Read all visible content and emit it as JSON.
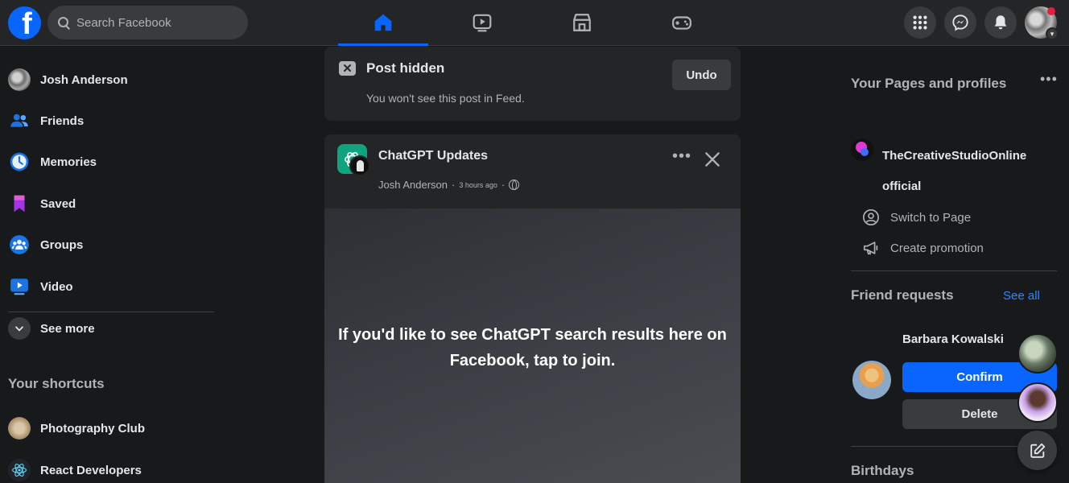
{
  "topbar": {
    "logo_letter": "f",
    "search_placeholder": "Search Facebook",
    "nav_tabs": [
      {
        "name": "Home",
        "icon": "home-icon",
        "active": true
      },
      {
        "name": "Watch",
        "icon": "video-icon",
        "active": false
      },
      {
        "name": "Marketplace",
        "icon": "marketplace-icon",
        "active": false
      },
      {
        "name": "Gaming",
        "icon": "gaming-icon",
        "active": false
      }
    ],
    "actions": [
      "menu-grid-icon",
      "messenger-icon",
      "notifications-icon"
    ],
    "accent_color": "#0866ff",
    "notification_dot_color": "#e41e3f"
  },
  "left_sidebar": {
    "items": [
      {
        "label": "Josh Anderson",
        "icon": "profile-avatar"
      },
      {
        "label": "Friends",
        "icon": "friends-icon"
      },
      {
        "label": "Memories",
        "icon": "memories-icon"
      },
      {
        "label": "Saved",
        "icon": "saved-icon"
      },
      {
        "label": "Groups",
        "icon": "groups-icon"
      },
      {
        "label": "Video",
        "icon": "video-icon"
      },
      {
        "label": "See more",
        "icon": "chevron-down-icon"
      }
    ],
    "shortcuts_title": "Your shortcuts",
    "shortcuts": [
      {
        "label": "Photography Club"
      },
      {
        "label": "React Developers"
      }
    ]
  },
  "feed": {
    "hidden_notice": {
      "title": "Post hidden",
      "text": "You won't see this post in Feed.",
      "undo_label": "Undo"
    },
    "post": {
      "page_name": "ChatGPT Updates",
      "author": "Josh Anderson",
      "time": "3 hours ago",
      "visibility_icon": "globe-icon",
      "media_text": "If you'd like to see ChatGPT search results here on Facebook, tap to join."
    }
  },
  "right_sidebar": {
    "pages_title": "Your Pages and profiles",
    "page_name": "TheCreativeStudioOnline official",
    "page_actions": [
      {
        "label": "Switch to Page",
        "icon": "switch-profile-icon"
      },
      {
        "label": "Create promotion",
        "icon": "megaphone-icon"
      }
    ],
    "friend_requests_title": "Friend requests",
    "see_all_label": "See all",
    "request_name": "Barbara Kowalski",
    "confirm_label": "Confirm",
    "delete_label": "Delete",
    "birthdays_title": "Birthdays"
  }
}
